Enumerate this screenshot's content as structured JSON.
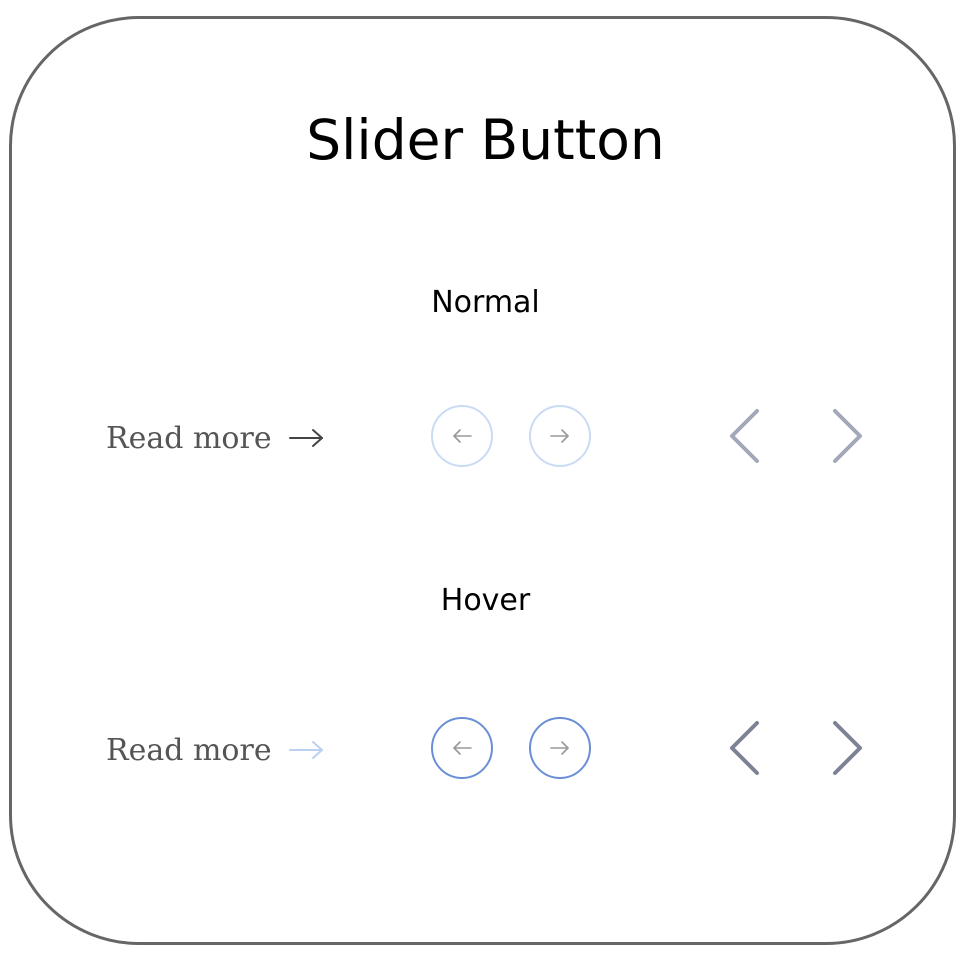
{
  "title": "Slider Button",
  "sections": {
    "normal": {
      "label": "Normal",
      "read_more_label": "Read more",
      "colors": {
        "read_more_arrow": "#444444",
        "circle_border": "#c9dbf5",
        "circle_arrow": "#999999",
        "chevron": "#a3a8ba"
      }
    },
    "hover": {
      "label": "Hover",
      "read_more_label": "Read more",
      "colors": {
        "read_more_arrow": "#bcd0f2",
        "circle_border": "#6a8fd6",
        "circle_arrow": "#999999",
        "chevron": "#7d8396"
      }
    }
  },
  "icons": {
    "read_more_arrow": "arrow-right-icon",
    "circle_prev": "arrow-left-icon",
    "circle_next": "arrow-right-icon",
    "chevron_prev": "chevron-left-icon",
    "chevron_next": "chevron-right-icon"
  }
}
